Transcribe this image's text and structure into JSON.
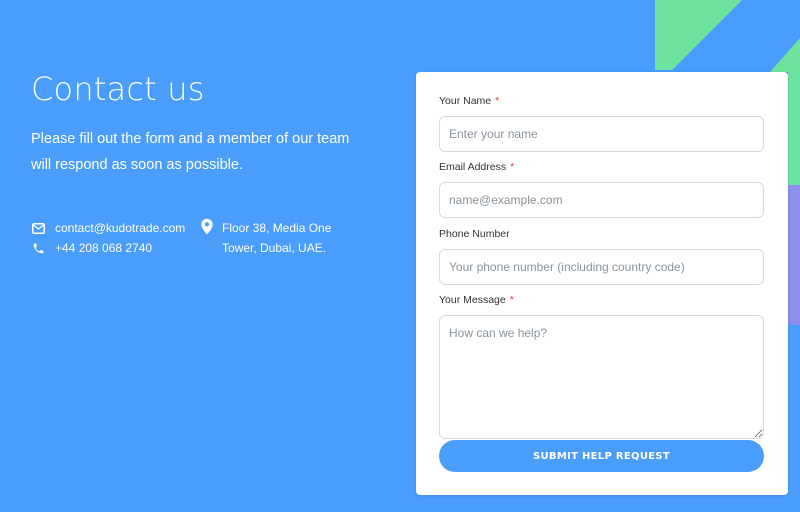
{
  "colors": {
    "background": "#4b9dfc",
    "accent_green": "#6ee3a0",
    "accent_purple": "#8a8ff0",
    "required": "#e53935"
  },
  "hero": {
    "title": "Contact us",
    "intro": "Please fill out the form and a member of our team will respond as soon as possible."
  },
  "contact": {
    "email": "contact@kudotrade.com",
    "phone": "+44 208 068 2740",
    "address_line1": "Floor 38, Media One",
    "address_line2": "Tower, Dubai, UAE.",
    "email_icon": "envelope-icon",
    "phone_icon": "phone-icon",
    "address_icon": "map-pin-icon"
  },
  "form": {
    "name": {
      "label": "Your Name",
      "required_mark": "*",
      "placeholder": "Enter your name",
      "value": ""
    },
    "email": {
      "label": "Email Address",
      "required_mark": "*",
      "placeholder": "name@example.com",
      "value": ""
    },
    "phone": {
      "label": "Phone Number",
      "placeholder": "Your phone number (including country code)",
      "value": ""
    },
    "message": {
      "label": "Your Message",
      "required_mark": "*",
      "placeholder": "How can we help?",
      "value": ""
    },
    "submit_label": "SUBMIT HELP REQUEST"
  }
}
